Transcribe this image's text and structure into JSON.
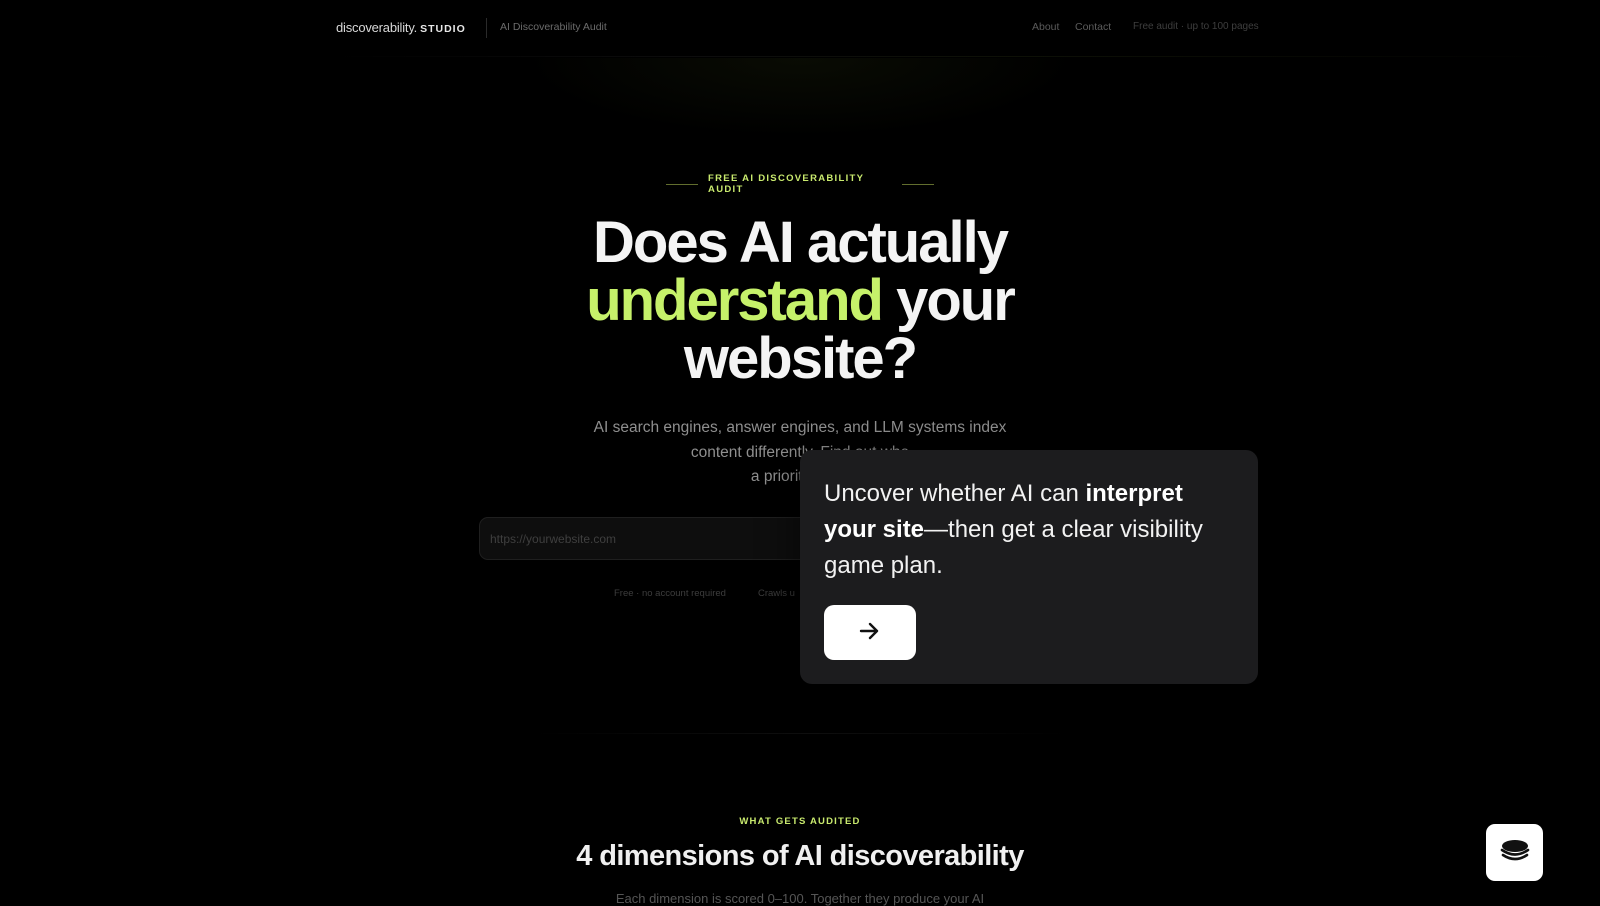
{
  "header": {
    "logo_text": "discoverability.",
    "logo_studio": "STUDIO",
    "product_label": "AI Discoverability Audit",
    "nav": {
      "about": "About",
      "contact": "Contact"
    },
    "free_note": "Free audit · up to 100 pages"
  },
  "hero": {
    "eyebrow": "FREE AI DISCOVERABILITY AUDIT",
    "headline_line1": "Does AI actually",
    "headline_accent": "understand",
    "headline_line2_rest": " your",
    "headline_line3": "website?",
    "subtitle_line1": "AI search engines, answer engines, and LLM systems index",
    "subtitle_line2": "content differently. Find out whe",
    "subtitle_line3": "a prioritized ro",
    "url_placeholder": "https://yourwebsite.com",
    "note_free": "Free · no account required",
    "note_crawls": "Crawls u"
  },
  "section": {
    "eyebrow": "WHAT GETS AUDITED",
    "title": "4 dimensions of AI discoverability",
    "subtitle": "Each dimension is scored 0–100. Together they produce your AI"
  },
  "tooltip": {
    "text_before": "Uncover whether AI can ",
    "text_bold": "interpret your site",
    "text_after": "—then get a clear visibility game plan.",
    "next_icon": "arrow-right-icon"
  },
  "fab": {
    "icon": "stack-icon"
  },
  "colors": {
    "background": "#000000",
    "accent": "#c6f16a",
    "tooltip_bg": "#1c1c1e",
    "button_bg": "#ffffff"
  }
}
